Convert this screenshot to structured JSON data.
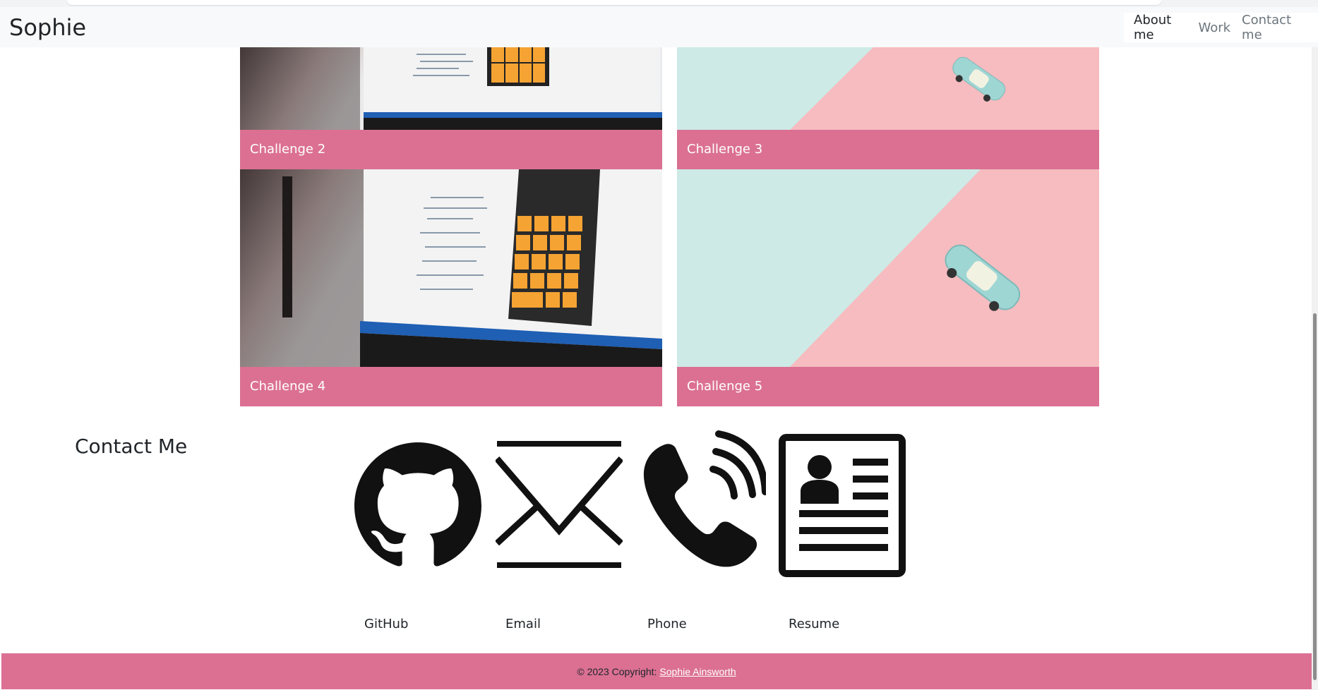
{
  "navbar": {
    "brand": "Sophie",
    "links": [
      "About me",
      "Work",
      "Contact me"
    ]
  },
  "work": {
    "cards": [
      {
        "caption": "Challenge 2",
        "image": "laptop-calculator"
      },
      {
        "caption": "Challenge 3",
        "image": "pastel-toy-car"
      },
      {
        "caption": "Challenge 4",
        "image": "laptop-calculator"
      },
      {
        "caption": "Challenge 5",
        "image": "pastel-toy-car"
      }
    ]
  },
  "contact": {
    "title": "Contact Me",
    "items": [
      {
        "label": "GitHub",
        "icon": "github-icon"
      },
      {
        "label": "Email",
        "icon": "envelope-icon"
      },
      {
        "label": "Phone",
        "icon": "phone-icon"
      },
      {
        "label": "Resume",
        "icon": "resume-icon"
      }
    ]
  },
  "footer": {
    "copyright": "© 2023 Copyright:",
    "author": "Sophie Ainsworth"
  },
  "colors": {
    "accent": "#db7093",
    "navbar_bg": "#f8f9fa"
  }
}
